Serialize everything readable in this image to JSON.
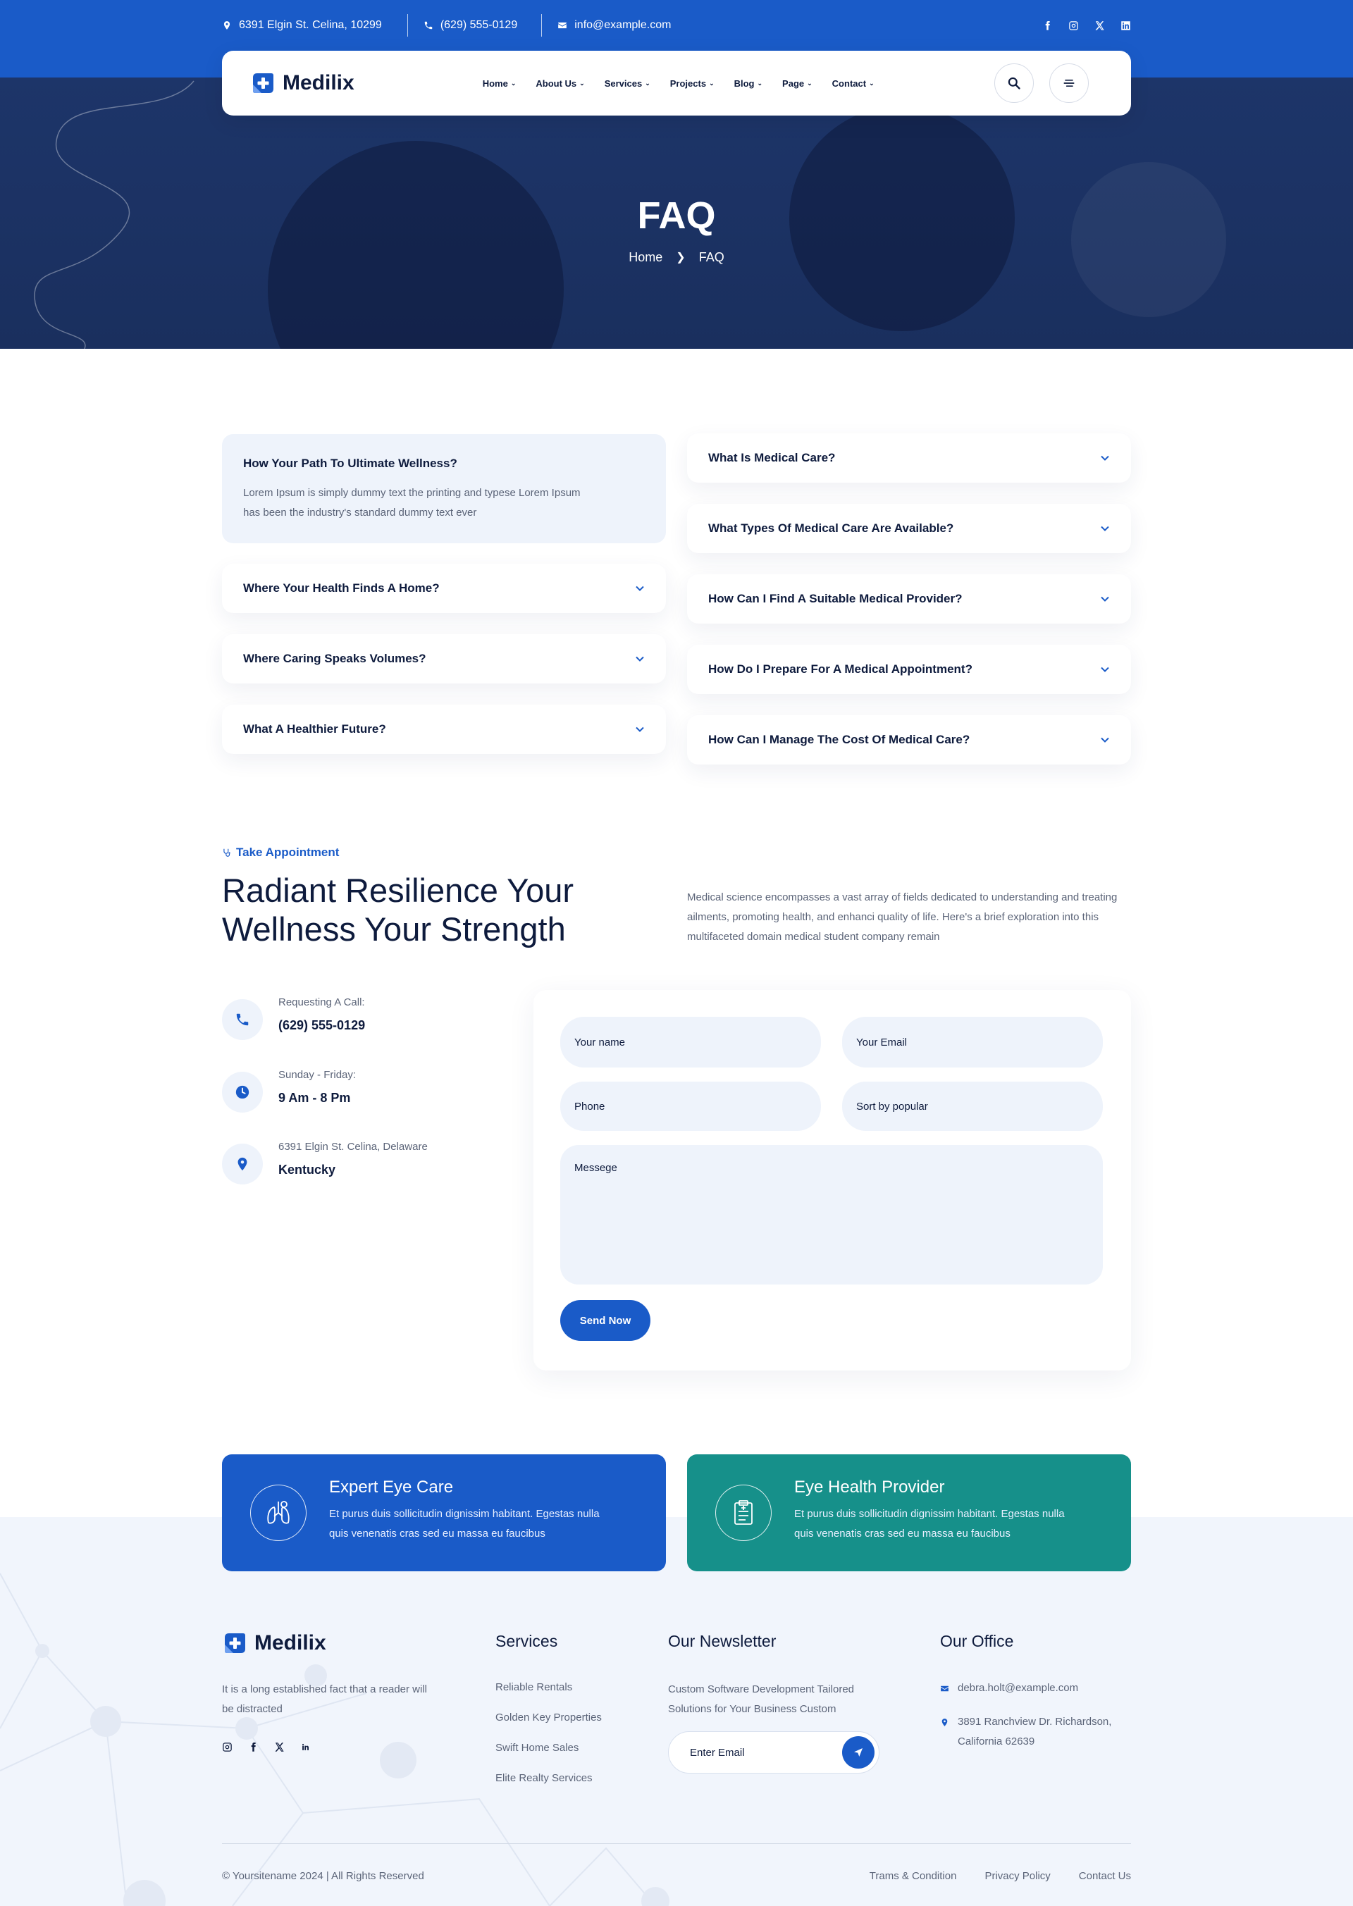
{
  "topbar": {
    "address": "6391 Elgin St. Celina, 10299",
    "phone": "(629) 555-0129",
    "email": "info@example.com",
    "social": [
      "facebook-icon",
      "instagram-icon",
      "x-icon",
      "linkedin-icon"
    ]
  },
  "nav": {
    "logo": "Medilix",
    "items": [
      {
        "label": "Home"
      },
      {
        "label": "About Us"
      },
      {
        "label": "Services"
      },
      {
        "label": "Projects"
      },
      {
        "label": "Blog"
      },
      {
        "label": "Page"
      },
      {
        "label": "Contact"
      }
    ]
  },
  "hero": {
    "title": "FAQ",
    "breadcrumb": [
      "Home",
      "FAQ"
    ]
  },
  "faq": {
    "left": {
      "open": {
        "question": "How Your Path To Ultimate Wellness?",
        "answer": "Lorem Ipsum is simply dummy text the printing and typese Lorem Ipsum has been the industry's standard dummy text ever"
      },
      "items": [
        "Where Your Health Finds A Home?",
        "Where Caring Speaks Volumes?",
        "What A Healthier Future?"
      ]
    },
    "right": {
      "items": [
        "What Is Medical Care?",
        "What Types Of Medical Care Are Available?",
        "How Can I Find A Suitable Medical Provider?",
        "How Do I Prepare For A Medical Appointment?",
        "How Can I Manage The Cost Of Medical Care?"
      ]
    }
  },
  "appointment": {
    "tagline": "Take Appointment",
    "title": "Radiant Resilience Your Wellness Your Strength",
    "description": "Medical science encompasses a vast array of fields dedicated to understanding and treating ailments, promoting health, and enhanci quality of life. Here's a brief exploration into this multifaceted domain medical student company remain",
    "info": [
      {
        "label": "Requesting A Call:",
        "value": "(629) 555-0129",
        "icon": "phone-icon"
      },
      {
        "label": "Sunday - Friday:",
        "value": "9 Am - 8 Pm",
        "icon": "clock-icon"
      },
      {
        "label": "6391 Elgin St. Celina, Delaware",
        "value": "Kentucky",
        "icon": "map-pin-icon"
      }
    ],
    "form": {
      "name": "Your name",
      "email": "Your Email",
      "phone": "Phone",
      "sort": "Sort by popular",
      "message": "Messege",
      "submit": "Send Now"
    }
  },
  "features": [
    {
      "title": "Expert Eye Care",
      "text": "Et purus duis sollicitudin dignissim habitant. Egestas nulla quis venenatis cras sed eu massa eu faucibus",
      "color": "#1a5bc8"
    },
    {
      "title": "Eye Health Provider",
      "text": "Et purus duis sollicitudin dignissim habitant. Egestas nulla quis venenatis cras sed eu massa eu faucibus",
      "color": "#16908a"
    }
  ],
  "footer": {
    "logo": "Medilix",
    "about": "It is a long established fact that a reader will be distracted",
    "services_title": "Services",
    "services": [
      "Reliable Rentals",
      "Golden Key Properties",
      "Swift Home Sales",
      "Elite Realty Services"
    ],
    "newsletter_title": "Our Newsletter",
    "newsletter_text": "Custom Software Development Tailored Solutions for Your Business Custom",
    "newsletter_placeholder": "Enter Email",
    "office_title": "Our Office",
    "office_email": "debra.holt@example.com",
    "office_address": "3891 Ranchview Dr. Richardson, California 62639",
    "copyright": "© Yoursitename  2024 | All Rights Reserved",
    "bottom_links": [
      "Trams & Condition",
      "Privacy Policy",
      "Contact Us"
    ]
  }
}
